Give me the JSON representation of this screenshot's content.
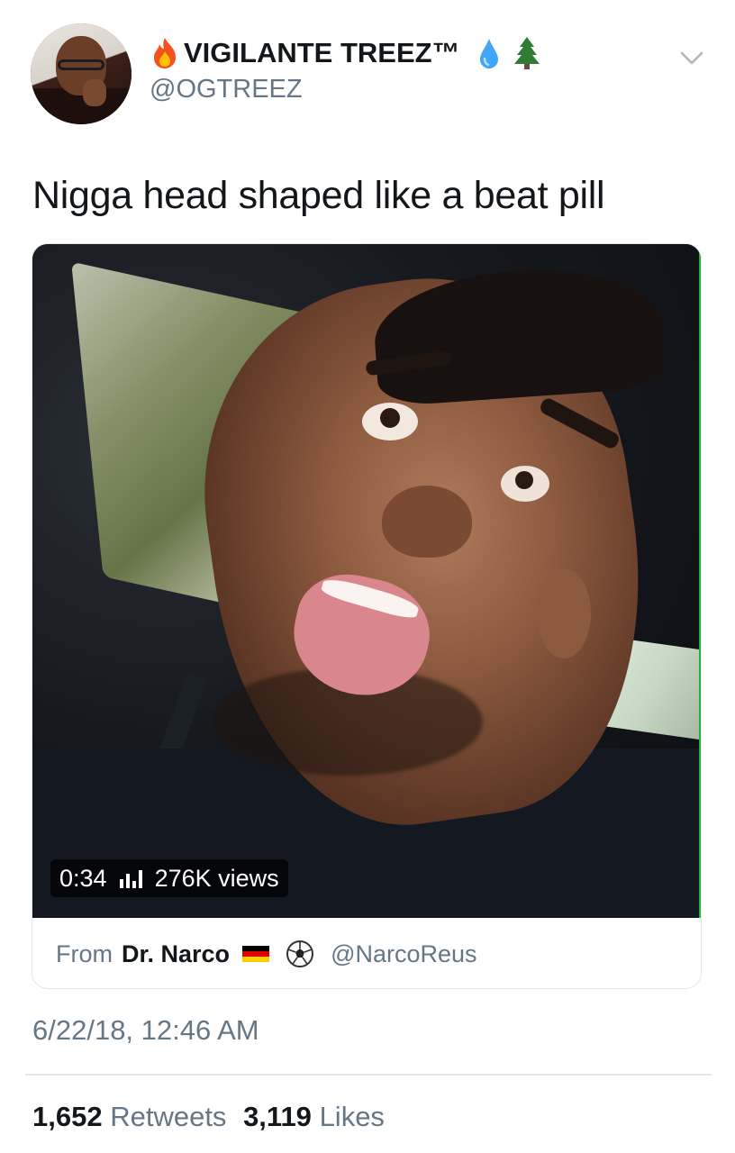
{
  "header": {
    "display_name": "VIGILANTE TREEZ™",
    "handle": "@OGTREEZ",
    "icons": [
      "fire-emoji",
      "droplet-emoji",
      "evergreen-tree-emoji"
    ],
    "menu_icon": "chevron-down-icon"
  },
  "tweet": {
    "text": "Nigga head shaped like a beat pill"
  },
  "video": {
    "duration": "0:34",
    "views": "276K views",
    "stats_icon": "analytics-bars-icon",
    "source_prefix": "From",
    "source_author": "Dr. Narco",
    "source_icons": [
      "germany-flag-emoji",
      "soccer-ball-emoji"
    ],
    "source_handle": "@NarcoReus"
  },
  "meta": {
    "timestamp": "6/22/18, 12:46 AM"
  },
  "stats": {
    "retweets_count": "1,652",
    "retweets_label": "Retweets",
    "likes_count": "3,119",
    "likes_label": "Likes"
  },
  "colors": {
    "text_primary": "#14171a",
    "text_secondary": "#657786",
    "border": "#e1e8ed"
  }
}
